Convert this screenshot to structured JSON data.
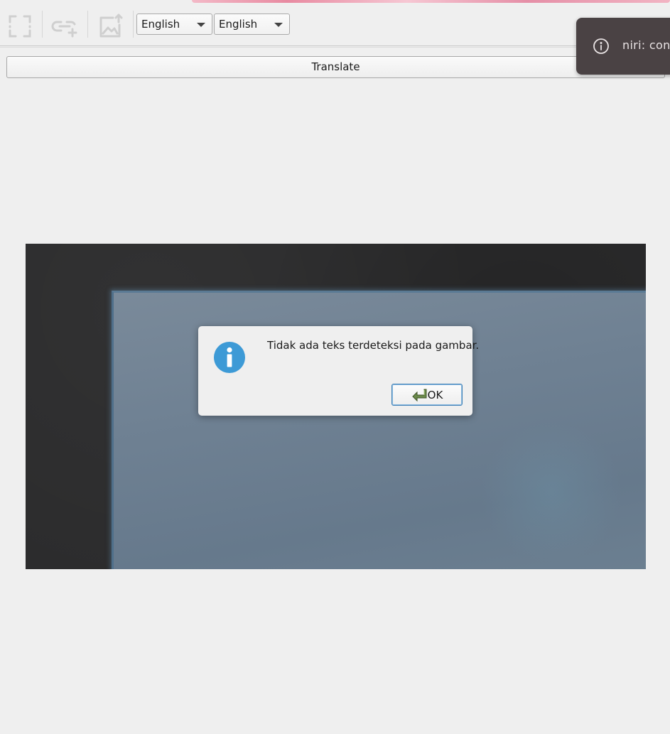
{
  "toolbar": {
    "icons": [
      "fullscreen-capture-icon",
      "link-add-icon",
      "image-upload-icon"
    ],
    "source_language": "English",
    "target_language": "English"
  },
  "translate_label": "Translate",
  "notification": {
    "icon": "info-circle-icon",
    "text": "niri: con"
  },
  "dialog": {
    "icon": "info-icon",
    "message": "Tidak ada teks terdeteksi pada gambar.",
    "ok_label": "OK"
  },
  "colors": {
    "background": "#efefef",
    "notification_bg": "#4a4244",
    "info_blue": "#3d9ad6",
    "focus_border": "#3d7fb5"
  }
}
